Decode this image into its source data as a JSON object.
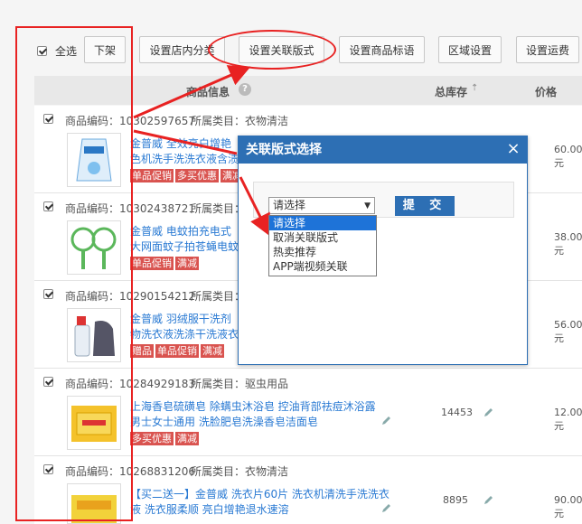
{
  "toolbar": {
    "select_all": "全选",
    "buttons": [
      "下架",
      "设置店内分类",
      "设置关联版式",
      "设置商品标语",
      "区域设置",
      "设置运费"
    ]
  },
  "table_header": {
    "product_info": "商品信息",
    "total_stock": "总库存",
    "price": "价格"
  },
  "rows": [
    {
      "code": "商品编码：10302597657",
      "category": "所属类目：衣物清洁",
      "title": [
        "金普威 全效亮白增艳",
        "色机洗手洗洗衣液含渍"
      ],
      "tags": [
        "单品促销",
        "多买优惠",
        "满减"
      ],
      "stock": "",
      "price": "60.00元"
    },
    {
      "code": "商品编码：10302438721",
      "category": "所属类目：",
      "title": [
        "金普威 电蚊拍充电式",
        "大网面蚊子拍苍蝇电蚊"
      ],
      "tags": [
        "单品促销",
        "满减"
      ],
      "stock": "",
      "price": "38.00元"
    },
    {
      "code": "商品编码：10290154212",
      "category": "所属类目：",
      "title": [
        "金普威 羽绒服干洗剂",
        "物洗衣液洗涤干洗液衣"
      ],
      "tags": [
        "赠品",
        "单品促销",
        "满减"
      ],
      "stock": "",
      "price": "56.00元"
    },
    {
      "code": "商品编码：10284929183",
      "category": "所属类目：驱虫用品",
      "title": [
        "上海香皂硫磺皂 除螨虫沐浴皂 控油背部祛痘沐浴露",
        "男士女士通用 洗脸肥皂洗澡香皂洁面皂"
      ],
      "tags": [
        "多买优惠",
        "满减"
      ],
      "stock": "14453",
      "price": "12.00元"
    },
    {
      "code": "商品编码：10268831206",
      "category": "所属类目：衣物清洁",
      "title": [
        "【买二送一】金普威 洗衣片60片 洗衣机清洗手洗洗衣",
        "液 洗衣服柔顺 亮白增艳退水速溶"
      ],
      "tags": [],
      "stock": "8895",
      "price": "90.00元"
    }
  ],
  "dialog": {
    "title": "关联版式选择",
    "close": "×",
    "select_value": "请选择",
    "submit": "提 交",
    "options": [
      "请选择",
      "取消关联版式",
      "热卖推荐",
      "APP端视频关联"
    ]
  },
  "colors": {
    "accent": "#2d6fb4",
    "highlight": "#e82222",
    "tag": "#d9534f",
    "link": "#2a7ad3"
  }
}
